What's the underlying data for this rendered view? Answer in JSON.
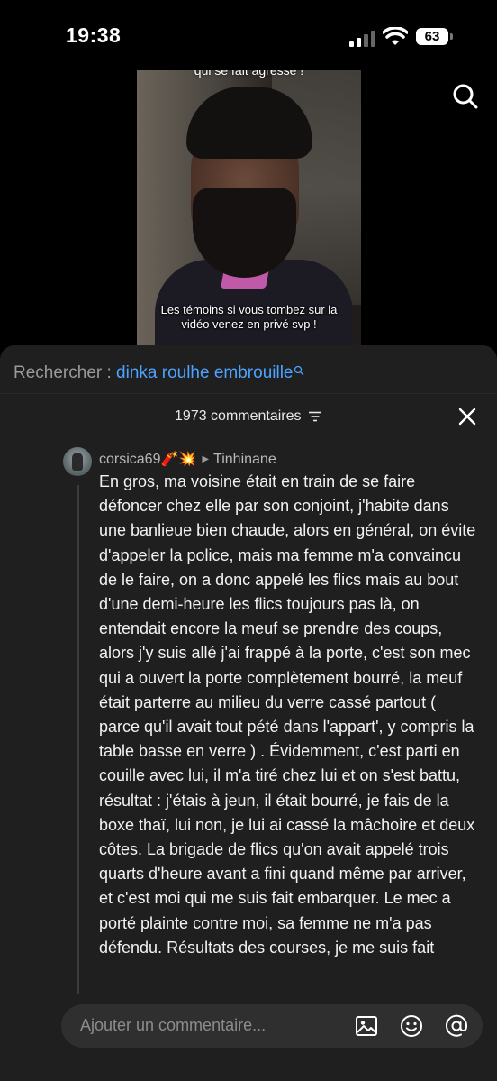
{
  "status": {
    "time": "19:38",
    "battery": "63"
  },
  "video": {
    "top_text": "qui se fait agressé !",
    "caption": "Les témoins si vous tombez sur la vidéo venez en privé svp !"
  },
  "search": {
    "label": "Rechercher : ",
    "query": "dinka roulhe embrouille"
  },
  "comments": {
    "count_label": "1973 commentaires"
  },
  "comment": {
    "username": "corsica69🧨💥",
    "reply_to": "Tinhinane",
    "text": "En gros, ma voisine était en train de se faire défoncer chez elle par son conjoint, j'habite dans une banlieue bien chaude, alors en général, on évite d'appeler la police, mais ma femme m'a convaincu de le faire, on a donc appelé les flics mais au bout d'une demi-heure les flics toujours pas là, on entendait encore la meuf se prendre des coups, alors j'y suis allé j'ai frappé à la porte, c'est son mec qui a ouvert la porte complètement bourré, la meuf était parterre au milieu du verre cassé partout ( parce qu'il avait tout pété dans l'appart', y compris la table basse en verre ) . Évidemment, c'est parti en couille avec lui, il m'a tiré chez lui et on s'est battu, résultat : j'étais à jeun, il était bourré, je fais de la boxe thaï, lui non, je lui ai cassé la mâchoire et deux côtes. La brigade de flics qu'on avait appelé trois quarts d'heure avant a fini quand même par arriver, et c'est moi qui me suis fait embarquer. Le mec a porté plainte contre moi, sa femme ne m'a pas défendu. Résultats des courses, je me suis fait"
  },
  "composer": {
    "placeholder": "Ajouter un commentaire..."
  },
  "icons": [
    "signal-icon",
    "wifi-icon",
    "battery-icon",
    "search-icon",
    "filter-icon",
    "close-icon",
    "image-icon",
    "emoji-icon",
    "mention-icon"
  ],
  "colors": {
    "accent_link": "#4da3ff",
    "panel_bg": "#1f1f1f",
    "composer_bg": "#2f2f2f"
  }
}
